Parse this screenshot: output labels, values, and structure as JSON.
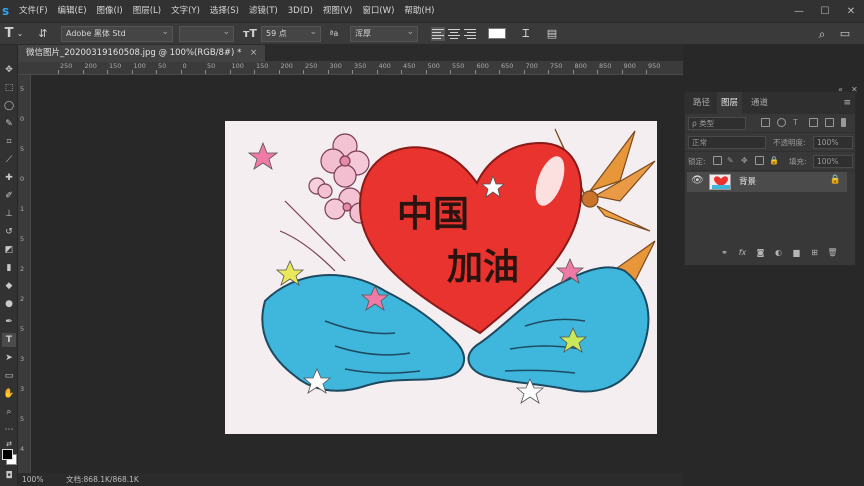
{
  "app": {
    "logo": "s"
  },
  "menu": [
    "文件(F)",
    "编辑(E)",
    "图像(I)",
    "图层(L)",
    "文字(Y)",
    "选择(S)",
    "滤镜(T)",
    "3D(D)",
    "视图(V)",
    "窗口(W)",
    "帮助(H)"
  ],
  "window_controls": {
    "minimize": "—",
    "maximize": "☐",
    "close": "✕"
  },
  "options": {
    "tool_glyph": "T",
    "font_family": "Adobe 黑体 Std",
    "font_style": "",
    "font_size": "59 点",
    "aa_symbol": "ªa",
    "anti_alias": "浑厚"
  },
  "document": {
    "tab_title": "微信图片_20200319160508.jpg @ 100%(RGB/8#) *",
    "tab_close": "×"
  },
  "ruler": {
    "h_labels": [
      "250",
      "200",
      "150",
      "100",
      "50",
      "0",
      "50",
      "100",
      "150",
      "200",
      "250",
      "300",
      "350",
      "400",
      "450",
      "500",
      "550",
      "600",
      "650",
      "700",
      "750",
      "800",
      "850",
      "900",
      "950"
    ],
    "v_labels": [
      "5",
      "0",
      "5",
      "0",
      "1",
      "5",
      "2",
      "2",
      "5",
      "3",
      "3",
      "5",
      "4"
    ]
  },
  "artwork": {
    "text_line1": "中国",
    "text_line2": "加油",
    "colors": {
      "heart": "#e8332e",
      "hands": "#3fb6dc",
      "paper": "#f4eef1",
      "flower": "#f3c2d3",
      "sunflower": "#e8963a"
    }
  },
  "status": {
    "zoom": "100%",
    "doc_size": "文档:868.1K/868.1K"
  },
  "panel": {
    "tabs": [
      "路径",
      "图层",
      "通道"
    ],
    "active_tab": "图层",
    "filter_kind": "ρ 类型",
    "blend_mode": "正常",
    "opacity_label": "不透明度:",
    "opacity_value": "100%",
    "lock_label": "锁定:",
    "fill_label": "填充:",
    "fill_value": "100%",
    "layer_name": "背景",
    "collapse": "«",
    "close": "✕",
    "menu": "≡"
  },
  "search_icon_label": "⌕"
}
